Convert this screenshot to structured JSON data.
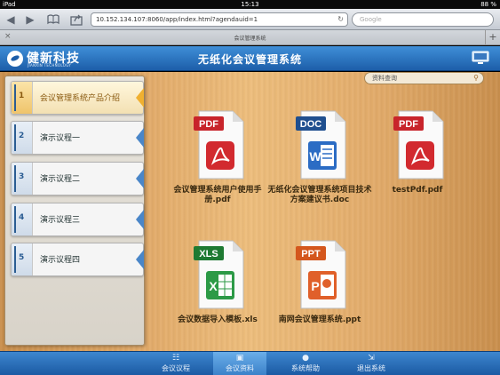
{
  "status_bar": {
    "device": "iPad",
    "time": "15:13",
    "battery": "88 %"
  },
  "browser": {
    "url": "10.152.134.107:8060/app/index.html?agendauid=1",
    "search_placeholder": "Google",
    "tab_title": "会议管理系统"
  },
  "header": {
    "brand": "健新科技",
    "brand_sub": "JIANXIN TECHNOLOGY",
    "title": "无纸化会议管理系统"
  },
  "sidebar": {
    "items": [
      {
        "num": "1",
        "label": "会议管理系统产品介绍"
      },
      {
        "num": "2",
        "label": "演示议程一"
      },
      {
        "num": "3",
        "label": "演示议程二"
      },
      {
        "num": "4",
        "label": "演示议程三"
      },
      {
        "num": "5",
        "label": "演示议程四"
      }
    ]
  },
  "doc_search": {
    "placeholder": "资料查询"
  },
  "documents": [
    {
      "type": "PDF",
      "name": "会议管理系统用户使用手册.pdf"
    },
    {
      "type": "DOC",
      "name": "无纸化会议管理系统项目技术方案建议书.doc"
    },
    {
      "type": "PDF",
      "name": "testPdf.pdf"
    },
    {
      "type": "XLS",
      "name": "会议数据导入模板.xls"
    },
    {
      "type": "PPT",
      "name": "南网会议管理系统.ppt"
    }
  ],
  "bottom_tabs": [
    {
      "label": "会议议程",
      "icon": "agenda-icon"
    },
    {
      "label": "会议资料",
      "icon": "briefcase-icon"
    },
    {
      "label": "系统帮助",
      "icon": "help-icon"
    },
    {
      "label": "退出系统",
      "icon": "exit-icon"
    }
  ],
  "colors": {
    "header_blue": "#1d5ea9",
    "pdf_red": "#c8242b",
    "doc_blue": "#1f4f8f",
    "xls_green": "#1e7a32",
    "ppt_orange": "#d4571d"
  }
}
